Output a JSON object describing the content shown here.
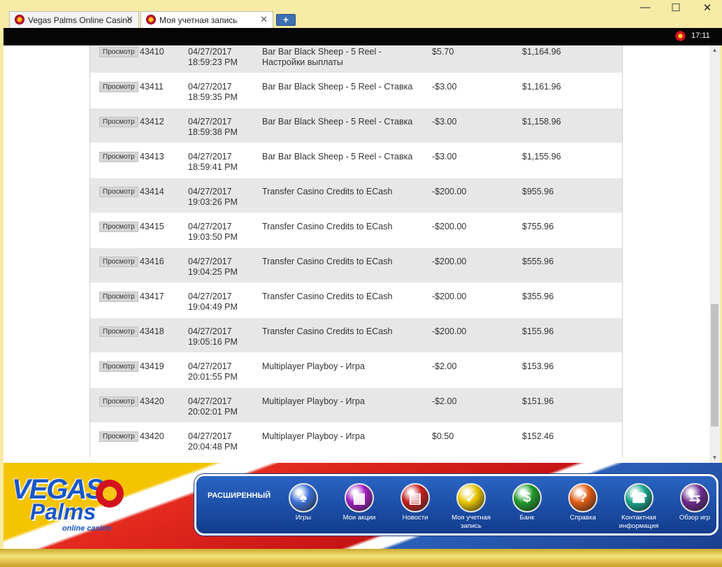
{
  "tabs": [
    {
      "label": "Vegas Palms Online Casino",
      "active": false
    },
    {
      "label": "Моя учетная запись",
      "active": true
    }
  ],
  "window_controls": {
    "minimize": "—",
    "maximize": "☐",
    "close": "✕"
  },
  "status": {
    "clock": "17:11"
  },
  "transactions": [
    {
      "view": "Просмотр",
      "id": "43410",
      "date": "04/27/2017",
      "time": "18:59:23 PM",
      "description": "Bar Bar Black Sheep - 5 Reel - Настройки выплаты",
      "amount": "$5.70",
      "balance": "$1,164.96"
    },
    {
      "view": "Просмотр",
      "id": "43411",
      "date": "04/27/2017",
      "time": "18:59:35 PM",
      "description": "Bar Bar Black Sheep - 5 Reel - Ставка",
      "amount": "-$3.00",
      "balance": "$1,161.96"
    },
    {
      "view": "Просмотр",
      "id": "43412",
      "date": "04/27/2017",
      "time": "18:59:38 PM",
      "description": "Bar Bar Black Sheep - 5 Reel - Ставка",
      "amount": "-$3.00",
      "balance": "$1,158.96"
    },
    {
      "view": "Просмотр",
      "id": "43413",
      "date": "04/27/2017",
      "time": "18:59:41 PM",
      "description": "Bar Bar Black Sheep - 5 Reel - Ставка",
      "amount": "-$3.00",
      "balance": "$1,155.96"
    },
    {
      "view": "Просмотр",
      "id": "43414",
      "date": "04/27/2017",
      "time": "19:03:26 PM",
      "description": "Transfer Casino Credits to ECash",
      "amount": "-$200.00",
      "balance": "$955.96"
    },
    {
      "view": "Просмотр",
      "id": "43415",
      "date": "04/27/2017",
      "time": "19:03:50 PM",
      "description": "Transfer Casino Credits to ECash",
      "amount": "-$200.00",
      "balance": "$755.96"
    },
    {
      "view": "Просмотр",
      "id": "43416",
      "date": "04/27/2017",
      "time": "19:04:25 PM",
      "description": "Transfer Casino Credits to ECash",
      "amount": "-$200.00",
      "balance": "$555.96"
    },
    {
      "view": "Просмотр",
      "id": "43417",
      "date": "04/27/2017",
      "time": "19:04:49 PM",
      "description": "Transfer Casino Credits to ECash",
      "amount": "-$200.00",
      "balance": "$355.96"
    },
    {
      "view": "Просмотр",
      "id": "43418",
      "date": "04/27/2017",
      "time": "19:05:16 PM",
      "description": "Transfer Casino Credits to ECash",
      "amount": "-$200.00",
      "balance": "$155.96"
    },
    {
      "view": "Просмотр",
      "id": "43419",
      "date": "04/27/2017",
      "time": "20:01:55 PM",
      "description": "Multiplayer Playboy - Игра",
      "amount": "-$2.00",
      "balance": "$153.96"
    },
    {
      "view": "Просмотр",
      "id": "43420",
      "date": "04/27/2017",
      "time": "20:02:01 PM",
      "description": "Multiplayer Playboy - Игра",
      "amount": "-$2.00",
      "balance": "$151.96"
    },
    {
      "view": "Просмотр",
      "id": "43420",
      "date": "04/27/2017",
      "time": "20:04:48 PM",
      "description": "Multiplayer Playboy - Игра",
      "amount": "$0.50",
      "balance": "$152.46"
    }
  ],
  "logo": {
    "line1": "VEGAS",
    "line2": "Palms",
    "tagline": "online casino"
  },
  "menu": {
    "title": "РАСШИРЕННЫЙ",
    "items": [
      {
        "label": "Игры",
        "icon": "cards-icon",
        "glyph": "♠",
        "color": "#3b6fd6"
      },
      {
        "label": "Мои акции",
        "icon": "gift-icon",
        "glyph": "▦",
        "color": "#a020c0"
      },
      {
        "label": "Новости",
        "icon": "news-icon",
        "glyph": "▤",
        "color": "#c81e1e"
      },
      {
        "label": "Моя учетная запись",
        "icon": "thumbs-up-icon",
        "glyph": "✓",
        "color": "#e8c400"
      },
      {
        "label": "Банк",
        "icon": "dollar-icon",
        "glyph": "$",
        "color": "#1e9a2a"
      },
      {
        "label": "Справка",
        "icon": "help-icon",
        "glyph": "?",
        "color": "#e25a12"
      },
      {
        "label": "Контактная информация",
        "icon": "phone-icon",
        "glyph": "☎",
        "color": "#17a48a"
      },
      {
        "label": "Обзор игр",
        "icon": "game-overview-icon",
        "glyph": "⇆",
        "color": "#6a2a8c"
      }
    ]
  }
}
